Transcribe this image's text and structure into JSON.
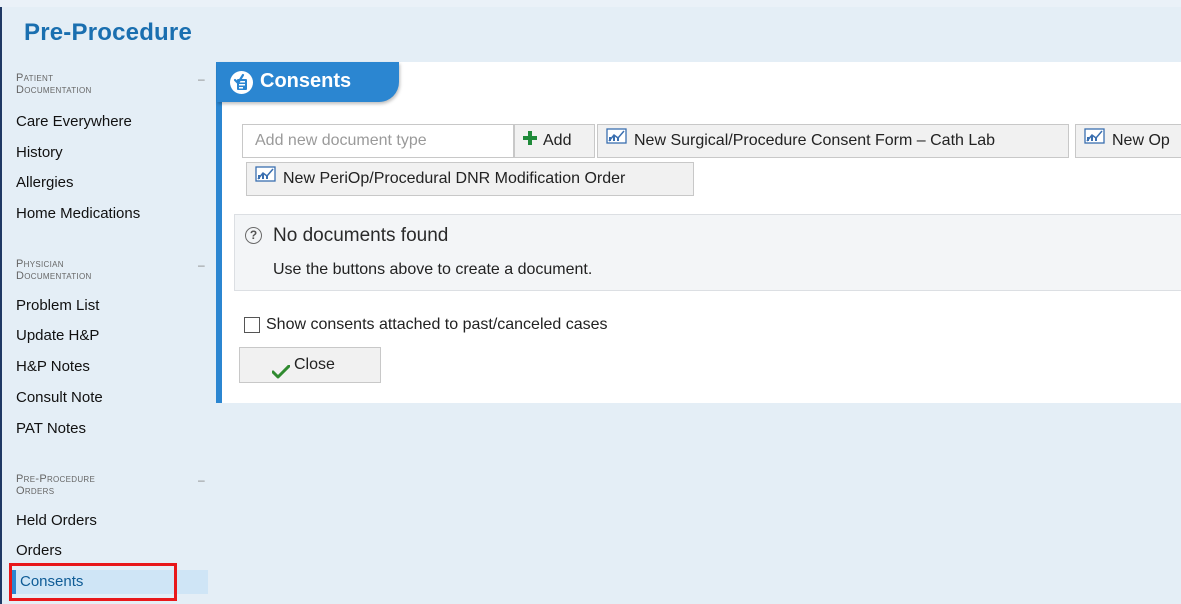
{
  "page": {
    "title": "Pre-Procedure"
  },
  "sidebar": {
    "sections": [
      {
        "header_line1": "Patient",
        "header_line2": "Documentation",
        "collapse": "–",
        "items": [
          "Care Everywhere",
          "History",
          "Allergies",
          "Home Medications"
        ]
      },
      {
        "header_line1": "Physician",
        "header_line2": "Documentation",
        "collapse": "–",
        "items": [
          "Problem List",
          "Update H&P",
          "H&P Notes",
          "Consult Note",
          "PAT Notes"
        ]
      },
      {
        "header_line1": "Pre-Procedure",
        "header_line2": "Orders",
        "collapse": "–",
        "items": [
          "Held Orders",
          "Orders",
          "Consents"
        ]
      }
    ],
    "active_item": "Consents"
  },
  "panel": {
    "title": "Consents",
    "icon": "consent-document-icon",
    "add_input_placeholder": "Add new document type",
    "add_button": "Add",
    "doc_buttons": [
      "New Surgical/Procedure Consent Form – Cath Lab",
      "New Op",
      "New PeriOp/Procedural DNR Modification Order"
    ],
    "empty_state": {
      "title": "No documents found",
      "subtitle": "Use the buttons above to create a document."
    },
    "show_past_checkbox": {
      "label": "Show consents attached to past/canceled cases",
      "checked": false
    },
    "close_button": "Close"
  },
  "colors": {
    "accent": "#2b86d1",
    "title": "#1a6fb0",
    "highlight": "#e8171a",
    "add_plus": "#1f8a3a",
    "close_check": "#2f8a2f"
  }
}
